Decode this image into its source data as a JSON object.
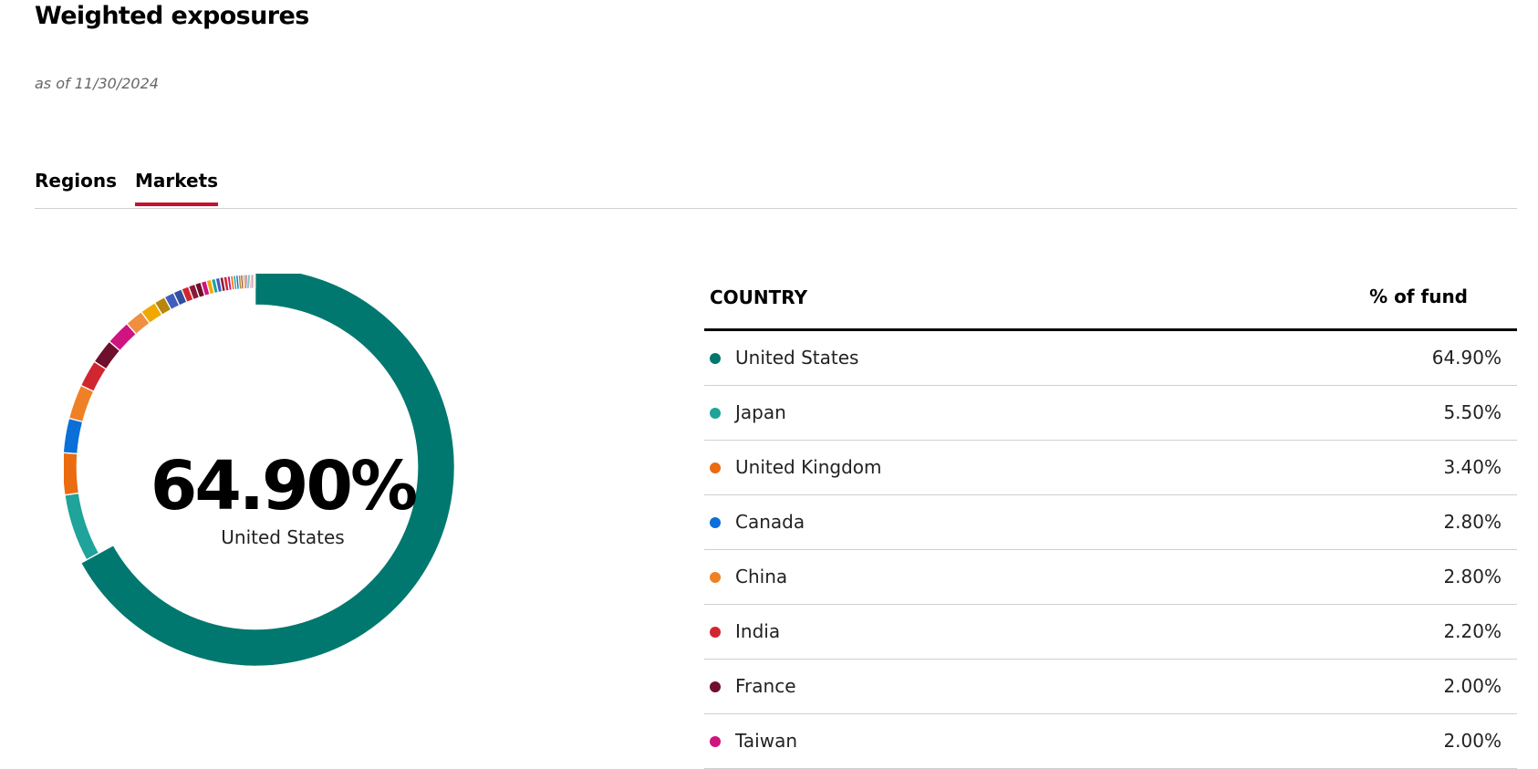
{
  "header": {
    "title": "Weighted exposures",
    "as_of": "as of 11/30/2024"
  },
  "tabs": [
    {
      "label": "Regions",
      "active": false
    },
    {
      "label": "Markets",
      "active": true
    }
  ],
  "accent_color": "#c8102e",
  "center": {
    "value": "64.90%",
    "label": "United States"
  },
  "table": {
    "headers": {
      "country": "COUNTRY",
      "pct": "% of fund"
    },
    "rows": [
      {
        "country": "United States",
        "pct": "64.90%",
        "color": "#00786f"
      },
      {
        "country": "Japan",
        "pct": "5.50%",
        "color": "#1fa39a"
      },
      {
        "country": "United Kingdom",
        "pct": "3.40%",
        "color": "#ea6b10"
      },
      {
        "country": "Canada",
        "pct": "2.80%",
        "color": "#0a6fd8"
      },
      {
        "country": "China",
        "pct": "2.80%",
        "color": "#f08026"
      },
      {
        "country": "India",
        "pct": "2.20%",
        "color": "#d12630"
      },
      {
        "country": "France",
        "pct": "2.00%",
        "color": "#6e0f2c"
      },
      {
        "country": "Taiwan",
        "pct": "2.00%",
        "color": "#cf1380"
      }
    ]
  },
  "chart_data": {
    "type": "pie",
    "title": "",
    "categories": [
      "United States",
      "Japan",
      "United Kingdom",
      "Canada",
      "China",
      "India",
      "France",
      "Taiwan"
    ],
    "values": [
      64.9,
      5.5,
      3.4,
      2.8,
      2.8,
      2.2,
      2.0,
      2.0
    ],
    "colors": [
      "#00786f",
      "#1fa39a",
      "#ea6b10",
      "#0a6fd8",
      "#f08026",
      "#d12630",
      "#6e0f2c",
      "#cf1380"
    ],
    "highlighted": "United States",
    "unlisted_slices": {
      "values": [
        1.5,
        1.3,
        0.9,
        0.8,
        0.7,
        0.6,
        0.55,
        0.5,
        0.45,
        0.4,
        0.35,
        0.35,
        0.3,
        0.3,
        0.25,
        0.25,
        0.2,
        0.2,
        0.2,
        0.15,
        0.15,
        0.15,
        0.12,
        0.12,
        0.1,
        0.1,
        0.1,
        0.08,
        0.08,
        0.06
      ],
      "colors": [
        "#f08f40",
        "#f0a800",
        "#b8860b",
        "#3f5fbf",
        "#2f4f9f",
        "#d12630",
        "#8b1a3a",
        "#6e0f2c",
        "#cf1380",
        "#f0a800",
        "#1fa39a",
        "#3f5fbf",
        "#8b1a3a",
        "#d12630",
        "#cf1380",
        "#f08026",
        "#1fa39a",
        "#0a6fd8",
        "#b8860b",
        "#6e0f2c",
        "#f0a800",
        "#3f5fbf",
        "#d12630",
        "#1fa39a",
        "#cf1380",
        "#f08026",
        "#8b1a3a",
        "#0a6fd8",
        "#f0a800",
        "#1fa39a"
      ]
    }
  }
}
